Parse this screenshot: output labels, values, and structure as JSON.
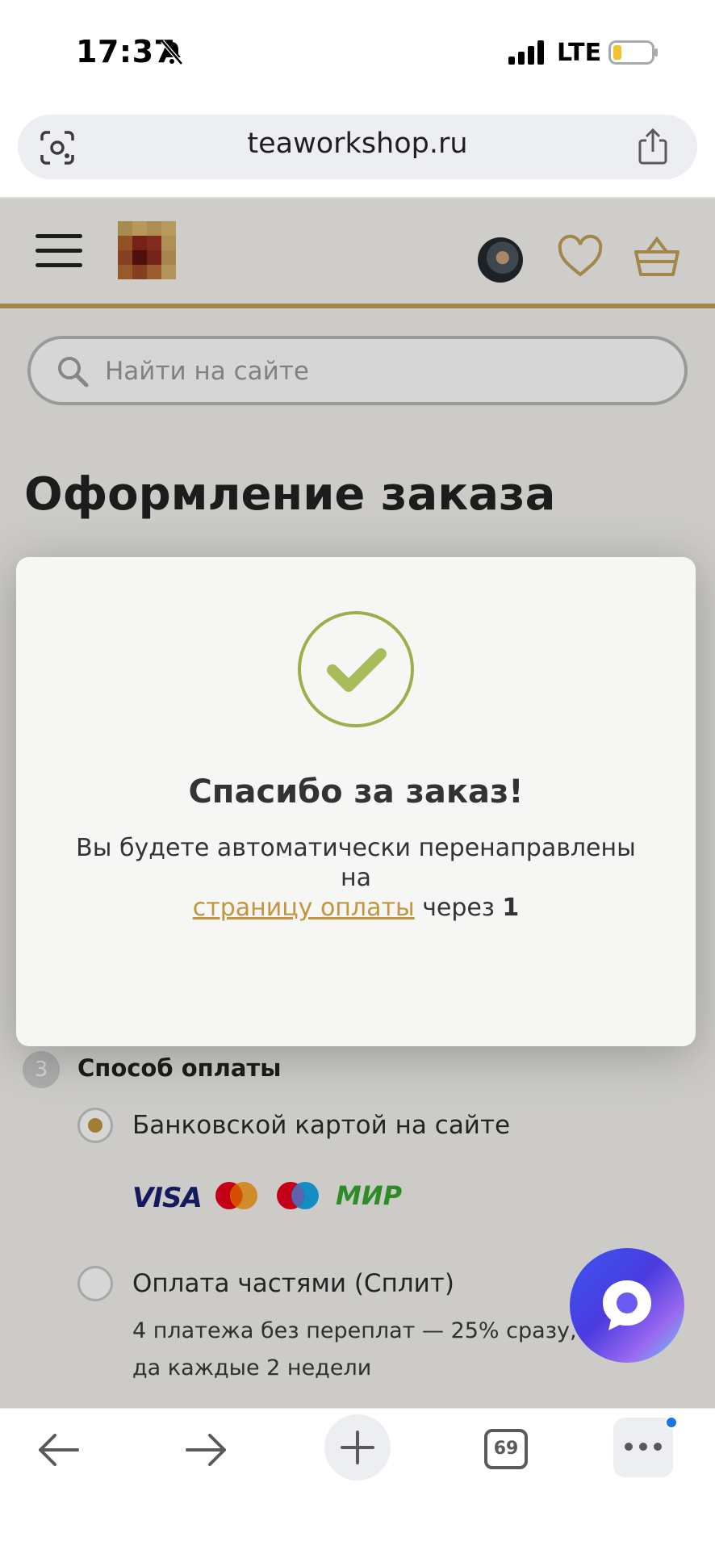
{
  "status_bar": {
    "time": "17:37",
    "network": "LTE",
    "icons": [
      "bell-muted-icon",
      "signal-icon",
      "battery-icon"
    ]
  },
  "browser": {
    "url": "teaworkshop.ru",
    "tab_count": "69",
    "icons": [
      "lens-icon",
      "share-icon",
      "back-icon",
      "forward-icon",
      "plus-icon",
      "more-icon"
    ]
  },
  "site_header": {
    "icons": [
      "menu-icon",
      "heart-icon",
      "basket-icon"
    ],
    "accent_color": "#c2a05a"
  },
  "search": {
    "placeholder": "Найти на сайте"
  },
  "page": {
    "title": "Оформление заказа"
  },
  "payment": {
    "step_number": "3",
    "step_title": "Способ оплаты",
    "options": [
      {
        "label": "Банковской картой на сайте",
        "selected": true,
        "logos": [
          "VISA",
          "mastercard",
          "maestro",
          "МИР"
        ]
      },
      {
        "label": "Оплата частями (Сплит)",
        "selected": false,
        "description": "4 платежа без переплат — 25% сразу, да каждые 2 недели"
      }
    ]
  },
  "modal": {
    "title": "Спасибо за заказ!",
    "text_before": "Вы будете автоматически перенаправлены на",
    "link_text": "страницу оплаты",
    "text_after": "через",
    "countdown": "1",
    "check_color": "#9bb04a"
  },
  "chat": {
    "icon": "chat-bubble-icon"
  }
}
